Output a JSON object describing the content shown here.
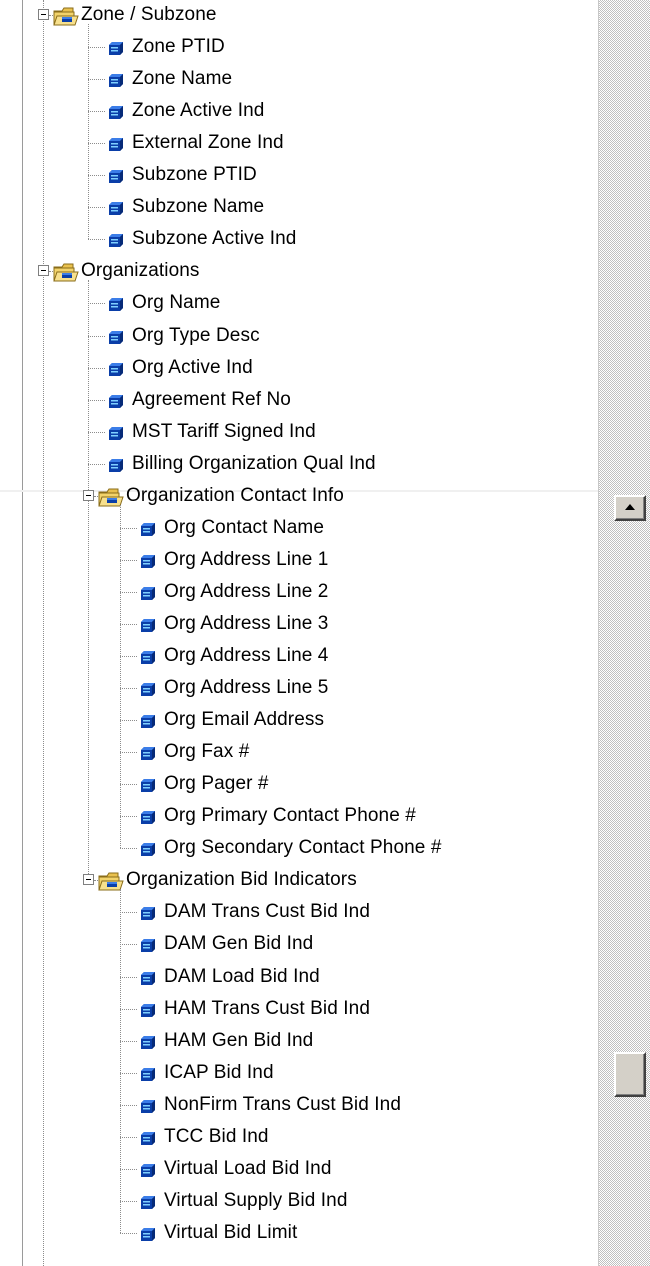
{
  "tree": {
    "zone_group": {
      "label": "Zone / Subzone",
      "fields": [
        "Zone PTID",
        "Zone Name",
        "Zone Active Ind",
        "External Zone Ind",
        "Subzone PTID",
        "Subzone Name",
        "Subzone Active Ind"
      ]
    },
    "org_group": {
      "label": "Organizations",
      "fields": [
        "Org Name",
        "Org Type Desc",
        "Org Active Ind",
        "Agreement Ref No",
        "MST Tariff Signed Ind",
        "Billing Organization Qual Ind"
      ]
    },
    "contact_group": {
      "label": "Organization Contact Info",
      "fields": [
        "Org Contact Name",
        "Org Address Line 1",
        "Org Address Line 2",
        "Org Address Line 3",
        "Org Address Line 4",
        "Org Address Line 5",
        "Org Email Address",
        "Org Fax #",
        "Org Pager #",
        "Org Primary Contact Phone #",
        "Org Secondary Contact Phone #"
      ]
    },
    "bid_group": {
      "label": "Organization Bid Indicators",
      "fields": [
        "DAM Trans Cust Bid Ind",
        "DAM Gen Bid Ind",
        "DAM Load Bid Ind",
        "HAM Trans Cust Bid Ind",
        "HAM Gen Bid Ind",
        "ICAP Bid Ind",
        "NonFirm Trans Cust Bid Ind",
        "TCC Bid Ind",
        "Virtual Load Bid Ind",
        "Virtual Supply Bid Ind",
        "Virtual Bid Limit"
      ]
    }
  },
  "icons": {
    "field": "table-field-icon",
    "folder": "open-folder-icon",
    "expander": "collapse-minus-icon",
    "scroll_up": "scroll-up-arrow-icon"
  },
  "colors": {
    "field_icon": "#0a3ea8",
    "folder": "#f2d36b",
    "background": "#ffffff",
    "scrollbar": "#d4d0c8"
  }
}
